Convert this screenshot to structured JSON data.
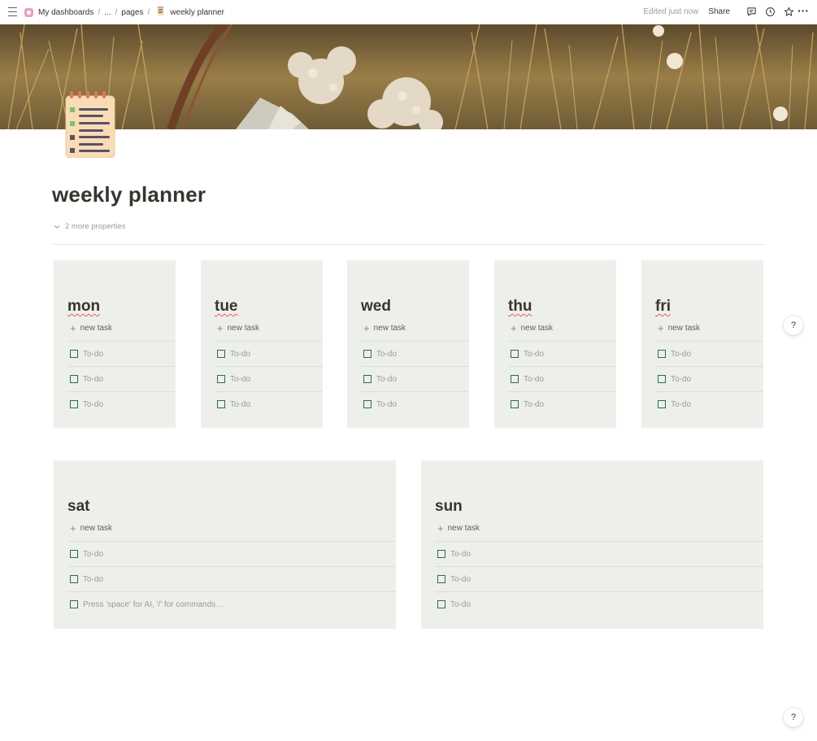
{
  "breadcrumb": {
    "workspace": "My dashboards",
    "ellipsis": "...",
    "folder": "pages",
    "page": "weekly planner"
  },
  "topbar": {
    "edited": "Edited just now",
    "share": "Share"
  },
  "page": {
    "title": "weekly planner",
    "properties_toggle": "2 more properties"
  },
  "days": [
    {
      "name": "mon",
      "new_task": "new task",
      "todos": [
        "To-do",
        "To-do",
        "To-do"
      ]
    },
    {
      "name": "tue",
      "new_task": "new task",
      "todos": [
        "To-do",
        "To-do",
        "To-do"
      ]
    },
    {
      "name": "wed",
      "new_task": "new task",
      "todos": [
        "To-do",
        "To-do",
        "To-do"
      ]
    },
    {
      "name": "thu",
      "new_task": "new task",
      "todos": [
        "To-do",
        "To-do",
        "To-do"
      ]
    },
    {
      "name": "fri",
      "new_task": "new task",
      "todos": [
        "To-do",
        "To-do",
        "To-do"
      ]
    },
    {
      "name": "sat",
      "new_task": "new task",
      "todos": [
        "To-do",
        "To-do",
        "Press 'space' for AI, '/' for commands…"
      ]
    },
    {
      "name": "sun",
      "new_task": "new task",
      "todos": [
        "To-do",
        "To-do",
        "To-do"
      ]
    }
  ],
  "help": "?",
  "colors": {
    "card_bg": "#edf0ea",
    "checkbox": "#2f6a4f",
    "text": "#37352f",
    "muted": "#9b9a97"
  }
}
